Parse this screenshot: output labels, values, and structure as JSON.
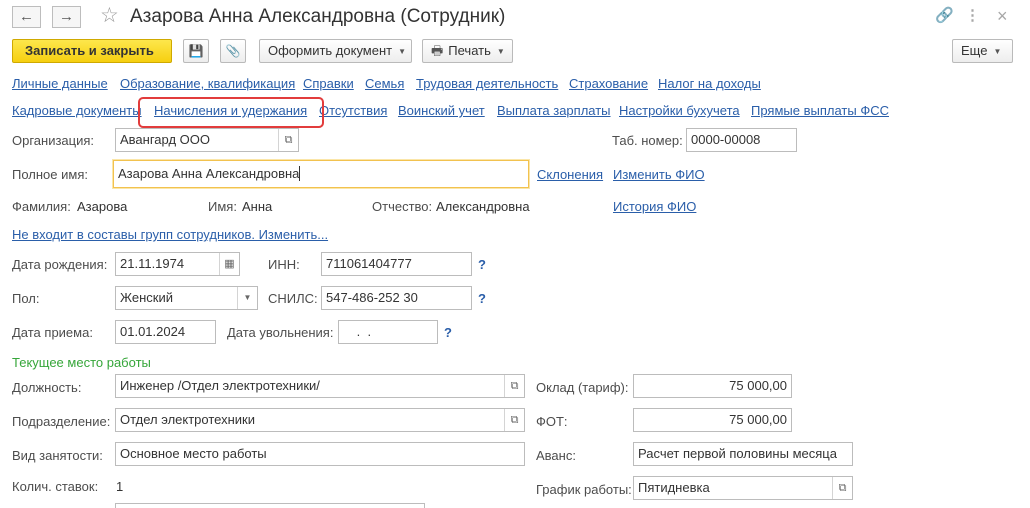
{
  "window": {
    "title": "Азарова Анна Александровна (Сотрудник)",
    "back_icon": "←",
    "forward_icon": "→",
    "star_icon": "☆",
    "link_icon": "🔗",
    "more_icon": "⋮",
    "close_icon": "×"
  },
  "toolbar": {
    "save_close_label": "Записать и закрыть",
    "save_icon": "💾",
    "attach_icon": "📎",
    "create_doc_label": "Оформить документ",
    "print_label": "Печать",
    "print_icon": "🖶",
    "more_label": "Еще",
    "caret": "▼"
  },
  "nav_links_row1": [
    "Личные данные",
    "Образование, квалификация",
    "Справки",
    "Семья",
    "Трудовая деятельность",
    "Страхование",
    "Налог на доходы"
  ],
  "nav_links_row2": [
    "Кадровые документы",
    "Начисления и удержания",
    "Отсутствия",
    "Воинский учет",
    "Выплата зарплаты",
    "Настройки бухучета",
    "Прямые выплаты ФСС"
  ],
  "form": {
    "org_label": "Организация:",
    "org_value": "Авангард ООО",
    "tab_no_label": "Таб. номер:",
    "tab_no_value": "0000-00008",
    "fullname_label": "Полное имя:",
    "fullname_value": "Азарова Анна Александровна",
    "declensions_link": "Склонения",
    "change_fio_link": "Изменить ФИО",
    "surname_label": "Фамилия:",
    "surname_value": "Азарова",
    "name_label": "Имя:",
    "name_value": "Анна",
    "patronymic_label": "Отчество:",
    "patronymic_value": "Александровна",
    "fio_history_link": "История ФИО",
    "groups_link": "Не входит в составы групп сотрудников. Изменить...",
    "birthdate_label": "Дата рождения:",
    "birthdate_value": "21.11.1974",
    "calendar_icon": "▦",
    "inn_label": "ИНН:",
    "inn_value": "711061404777",
    "help_mark": "?",
    "gender_label": "Пол:",
    "gender_value": "Женский",
    "snils_label": "СНИЛС:",
    "snils_value": "547-486-252 30",
    "hire_date_label": "Дата приема:",
    "hire_date_value": "01.01.2024",
    "dismissal_label": "Дата увольнения:",
    "dismissal_value": " .  .",
    "open_icon": "⧉"
  },
  "work": {
    "section_title": "Текущее место работы",
    "position_label": "Должность:",
    "position_value": "Инженер /Отдел электротехники/",
    "salary_label": "Оклад (тариф):",
    "salary_value": "75 000,00",
    "department_label": "Подразделение:",
    "department_value": "Отдел электротехники",
    "fot_label": "ФОТ:",
    "fot_value": "75 000,00",
    "employment_label": "Вид занятости:",
    "employment_value": "Основное место работы",
    "advance_label": "Аванс:",
    "advance_value": "Расчет первой половины месяца",
    "rates_label": "Колич. ставок:",
    "rates_value": "1",
    "schedule_label": "График работы:",
    "schedule_value": "Пятидневка"
  }
}
